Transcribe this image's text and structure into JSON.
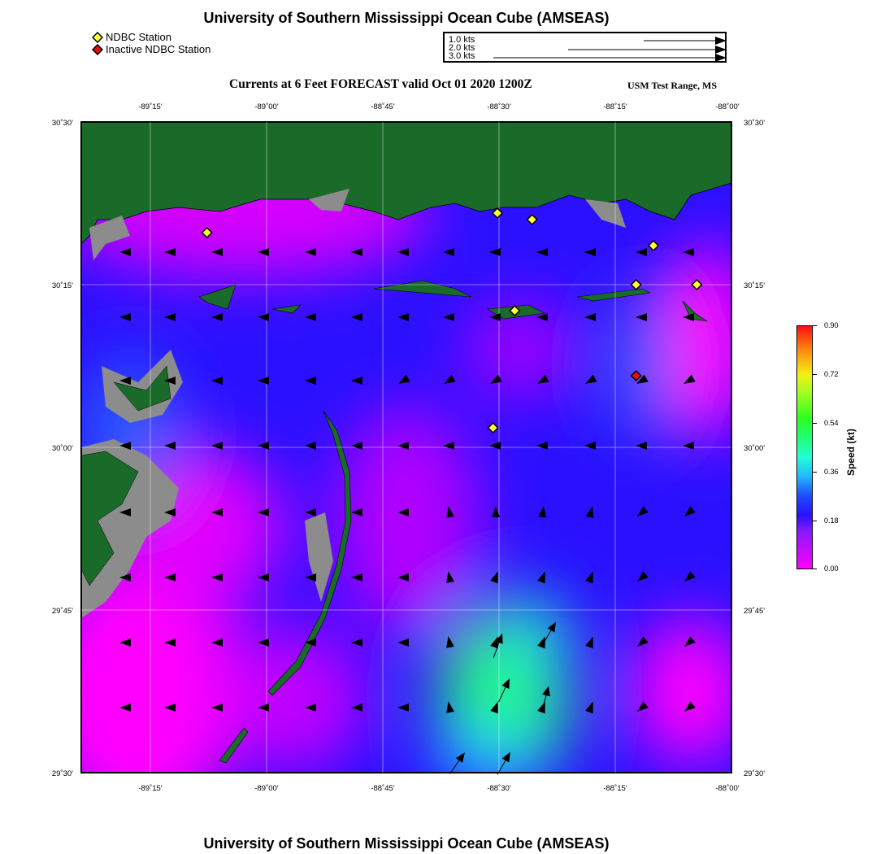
{
  "page_title": "University of Southern Mississippi Ocean Cube (AMSEAS)",
  "legend": {
    "station": "NDBC Station",
    "inactive_station": "Inactive NDBC Station",
    "station_color": "#ffff33",
    "inactive_color": "#dd1111"
  },
  "vector_key": [
    "1.0 kts",
    "2.0 kts",
    "3.0 kts"
  ],
  "subtitle": "Currents at 6 Feet FORECAST valid Oct 01 2020 1200Z",
  "location": "USM Test Range, MS",
  "axes": {
    "lon_ticks": [
      "-89˚15'",
      "-89˚00'",
      "-88˚45'",
      "-88˚30'",
      "-88˚15'",
      "-88˚00'"
    ],
    "lat_ticks": [
      "30˚30'",
      "30˚15'",
      "30˚00'",
      "29˚45'",
      "29˚30'"
    ]
  },
  "colorbar": {
    "label": "Speed (kt)",
    "ticks": [
      "0.90",
      "0.72",
      "0.54",
      "0.36",
      "0.18",
      "0.00"
    ]
  },
  "colors": {
    "land": "#1a6b2a",
    "marsh": "#8c8c8c",
    "low_speed": "#ff00ff",
    "mid_speed": "#2a10ff",
    "high_speed": "#22ffd6"
  },
  "stations": [
    {
      "lon": -89.21,
      "lat": 30.33,
      "status": "active"
    },
    {
      "lon": -88.54,
      "lat": 30.36,
      "status": "active"
    },
    {
      "lon": -88.46,
      "lat": 30.35,
      "status": "active"
    },
    {
      "lon": -88.18,
      "lat": 30.31,
      "status": "active"
    },
    {
      "lon": -88.22,
      "lat": 30.25,
      "status": "active"
    },
    {
      "lon": -88.08,
      "lat": 30.25,
      "status": "active"
    },
    {
      "lon": -88.5,
      "lat": 30.21,
      "status": "active"
    },
    {
      "lon": -88.55,
      "lat": 30.03,
      "status": "active"
    },
    {
      "lon": -88.22,
      "lat": 30.11,
      "status": "inactive"
    }
  ]
}
